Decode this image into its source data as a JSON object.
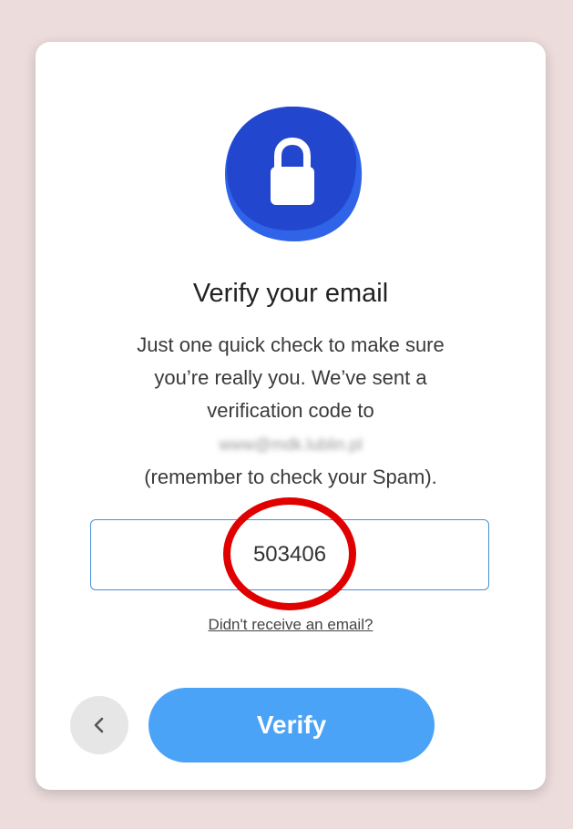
{
  "verify_card": {
    "title": "Verify your email",
    "description_lines": [
      "Just one quick check to make sure",
      "you’re really you. We’ve sent a",
      "verification code to"
    ],
    "email_masked": "www@mdk.lublin.pl",
    "spam_note": "(remember to check your Spam).",
    "code_value": "503406",
    "resend_link": "Didn't receive an email?",
    "verify_button": "Verify",
    "back_icon": "chevron-left-icon",
    "lock_icon": "lock-icon"
  },
  "colors": {
    "background": "#ecdcdc",
    "card": "#ffffff",
    "lock_badge": "#2a4fd6",
    "input_border": "#4a90d9",
    "verify_button": "#4aa3f7",
    "annotation": "#e10000"
  }
}
